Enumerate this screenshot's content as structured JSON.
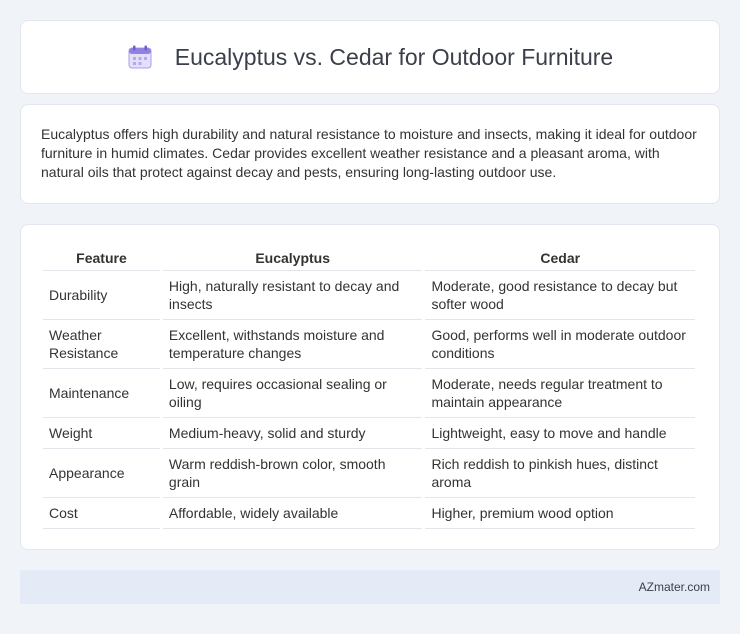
{
  "header": {
    "title": "Eucalyptus vs. Cedar for Outdoor Furniture",
    "icon": "calendar-icon"
  },
  "intro": {
    "text": "Eucalyptus offers high durability and natural resistance to moisture and insects, making it ideal for outdoor furniture in humid climates. Cedar provides excellent weather resistance and a pleasant aroma, with natural oils that protect against decay and pests, ensuring long-lasting outdoor use."
  },
  "table": {
    "headers": [
      "Feature",
      "Eucalyptus",
      "Cedar"
    ],
    "rows": [
      [
        "Durability",
        "High, naturally resistant to decay and insects",
        "Moderate, good resistance to decay but softer wood"
      ],
      [
        "Weather Resistance",
        "Excellent, withstands moisture and temperature changes",
        "Good, performs well in moderate outdoor conditions"
      ],
      [
        "Maintenance",
        "Low, requires occasional sealing or oiling",
        "Moderate, needs regular treatment to maintain appearance"
      ],
      [
        "Weight",
        "Medium-heavy, solid and sturdy",
        "Lightweight, easy to move and handle"
      ],
      [
        "Appearance",
        "Warm reddish-brown color, smooth grain",
        "Rich reddish to pinkish hues, distinct aroma"
      ],
      [
        "Cost",
        "Affordable, widely available",
        "Higher, premium wood option"
      ]
    ]
  },
  "footer": {
    "text": "AZmater.com"
  },
  "colors": {
    "background": "#f0f3f8",
    "footer_bg": "#e5ebf6",
    "icon_accent": "#7b6fd6"
  }
}
